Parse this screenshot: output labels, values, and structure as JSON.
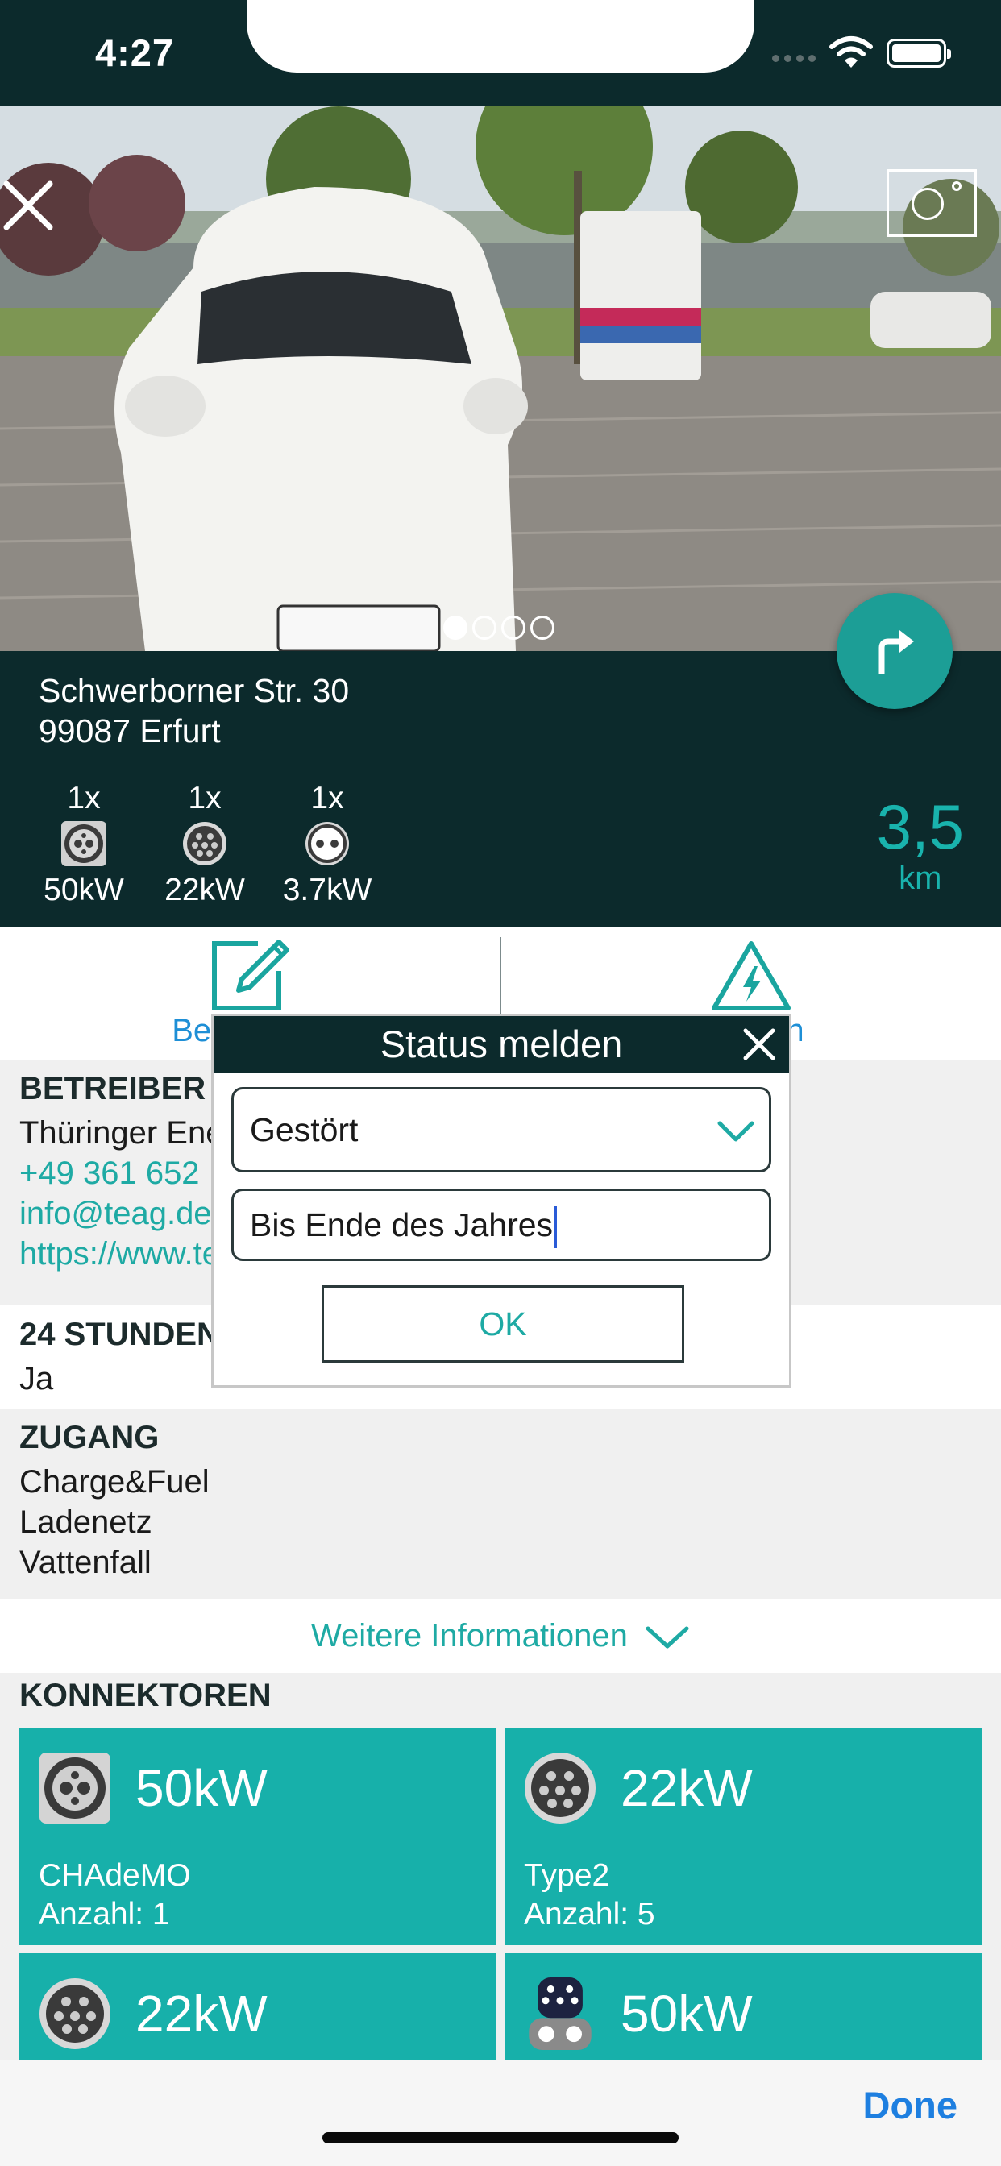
{
  "status_bar": {
    "time": "4:27"
  },
  "location": {
    "street": "Schwerborner Str. 30",
    "city": "99087 Erfurt",
    "distance_value": "3,5",
    "distance_unit": "km",
    "plugs": [
      {
        "count": "1x",
        "power": "50kW",
        "icon": "chademo-plug-icon"
      },
      {
        "count": "1x",
        "power": "22kW",
        "icon": "type2-plug-icon"
      },
      {
        "count": "1x",
        "power": "3.7kW",
        "icon": "schuko-plug-icon"
      }
    ],
    "photo_pages": 4,
    "photo_active_index": 0
  },
  "actions": {
    "edit_label": "Bearbeiten",
    "report_label": "Melden"
  },
  "operator": {
    "title": "BETREIBER",
    "name": "Thüringer Energie",
    "phone": "+49 361 652",
    "email": "info@teag.de",
    "website": "https://www.teag.de"
  },
  "hours": {
    "title": "24 STUNDEN",
    "value": "Ja"
  },
  "access": {
    "title": "ZUGANG",
    "items": [
      "Charge&Fuel",
      "Ladenetz",
      "Vattenfall"
    ]
  },
  "more_info_label": "Weitere Informationen",
  "connectors": {
    "title": "KONNEKTOREN",
    "tiles": [
      {
        "power": "50kW",
        "type": "CHAdeMO",
        "count": "Anzahl: 1"
      },
      {
        "power": "22kW",
        "type": "Type2",
        "count": "Anzahl: 5"
      },
      {
        "power": "22kW",
        "type": "",
        "count": ""
      },
      {
        "power": "50kW",
        "type": "",
        "count": ""
      }
    ]
  },
  "dialog": {
    "title": "Status melden",
    "selected_status": "Gestört",
    "comment": "Bis Ende des Jahres",
    "ok_label": "OK"
  },
  "toolbar": {
    "done_label": "Done"
  },
  "colors": {
    "dark": "#0c2a2c",
    "teal": "#17b0aa",
    "link": "#1eaaa4",
    "ios_blue": "#1e7fe0"
  }
}
